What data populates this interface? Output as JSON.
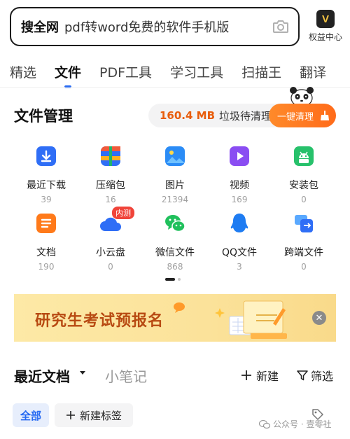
{
  "search": {
    "brand": "搜全网",
    "query": "pdf转word免费的软件手机版",
    "camera_icon": "camera-icon"
  },
  "rights_center": {
    "label": "权益中心",
    "badge": "V"
  },
  "tabs": [
    {
      "label": "精选",
      "active": false
    },
    {
      "label": "文件",
      "active": true
    },
    {
      "label": "PDF工具",
      "active": false
    },
    {
      "label": "学习工具",
      "active": false
    },
    {
      "label": "扫描王",
      "active": false
    },
    {
      "label": "翻译",
      "active": false
    }
  ],
  "file_management": {
    "title": "文件管理",
    "junk_size": "160.4 MB",
    "junk_text": "垃圾待清理",
    "clean_button": "一键清理"
  },
  "file_categories": [
    {
      "label": "最近下载",
      "count": "39",
      "icon": "download-icon",
      "color": "#2f6ef6"
    },
    {
      "label": "压缩包",
      "count": "16",
      "icon": "archive-icon",
      "color": "#f05a3a"
    },
    {
      "label": "图片",
      "count": "21394",
      "icon": "image-icon",
      "color": "#2b8cf6"
    },
    {
      "label": "视频",
      "count": "169",
      "icon": "video-icon",
      "color": "#8a4df2"
    },
    {
      "label": "安装包",
      "count": "0",
      "icon": "android-icon",
      "color": "#27c16b"
    },
    {
      "label": "文档",
      "count": "190",
      "icon": "document-icon",
      "color": "#ff7a1a"
    },
    {
      "label": "小云盘",
      "count": "0",
      "icon": "cloud-icon",
      "color": "#2f6ef6",
      "badge": "内测"
    },
    {
      "label": "微信文件",
      "count": "868",
      "icon": "wechat-icon",
      "color": "#20c05c"
    },
    {
      "label": "QQ文件",
      "count": "3",
      "icon": "qq-icon",
      "color": "#1e7cf2"
    },
    {
      "label": "跨端文件",
      "count": "0",
      "icon": "cross-device-icon",
      "color": "#2f8af6"
    }
  ],
  "banner": {
    "text": "研究生考试预报名",
    "close_icon": "close-icon"
  },
  "recent": {
    "title": "最近文档",
    "notes_tab": "小笔记",
    "new_label": "新建",
    "filter_label": "筛选"
  },
  "chips": {
    "all": "全部",
    "new_tag": "新建标签"
  },
  "watermark": "公众号 · 壹零社"
}
